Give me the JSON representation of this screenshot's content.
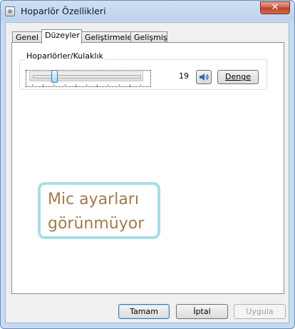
{
  "window": {
    "title": "Hoparlör Özellikleri",
    "close_glyph": "✕"
  },
  "tabs": [
    {
      "label": "Genel",
      "active": false
    },
    {
      "label": "Düzeyler",
      "active": true
    },
    {
      "label": "Geliştirmeler",
      "active": false
    },
    {
      "label": "Gelişmiş",
      "active": false
    }
  ],
  "levels": {
    "group_label": "Hoparlörler/Kulaklık",
    "volume": 19,
    "volume_text": "19",
    "speaker_icon": "speaker-icon",
    "balance_label": "Denge"
  },
  "annotation": {
    "line1": "Mic ayarları",
    "line2": "görünmüyor",
    "border_color": "#a8dde6",
    "text_color": "#a3794e"
  },
  "buttons": {
    "ok": "Tamam",
    "cancel": "İptal",
    "apply": "Uygula",
    "apply_disabled": true
  }
}
